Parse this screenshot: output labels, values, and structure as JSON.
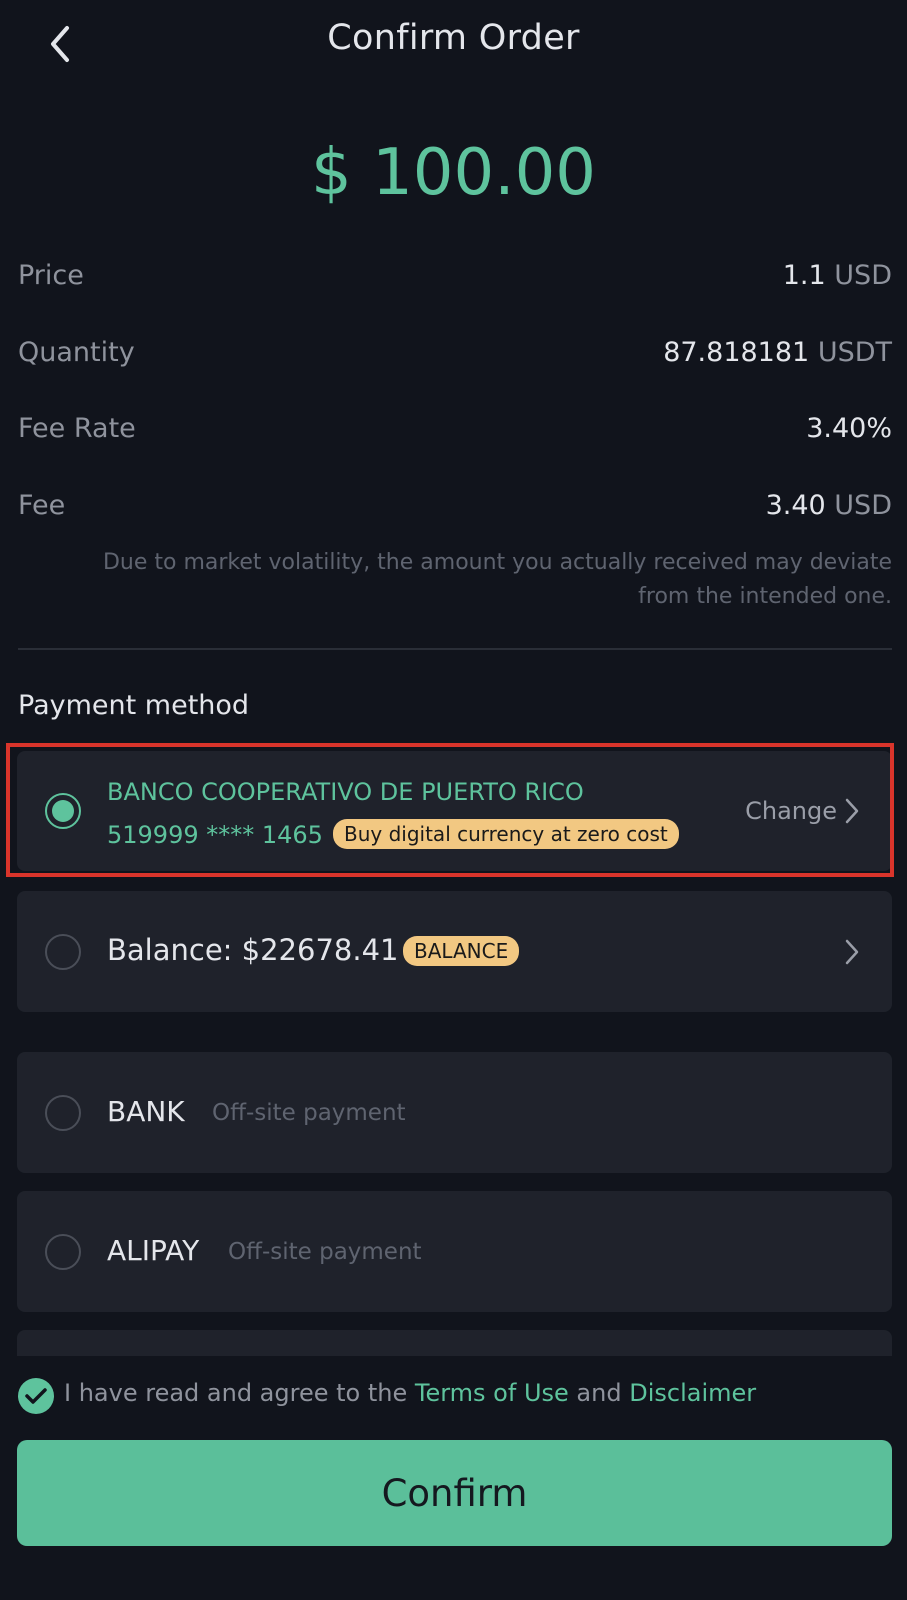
{
  "header": {
    "title": "Confirm Order",
    "back_icon": "chevron-left-icon"
  },
  "order": {
    "amount": "$ 100.00",
    "rows": [
      {
        "label": "Price",
        "value": "1.1",
        "unit": "USD"
      },
      {
        "label": "Quantity",
        "value": "87.818181",
        "unit": "USDT"
      },
      {
        "label": "Fee Rate",
        "value": "3.40%",
        "unit": ""
      },
      {
        "label": "Fee",
        "value": "3.40",
        "unit": "USD"
      }
    ],
    "note_line1": "Due to market volatility, the amount you actually received may deviate",
    "note_line2": "from the intended one."
  },
  "payment": {
    "title": "Payment method",
    "selected_card": {
      "bank_name": "BANCO COOPERATIVO DE PUERTO RICO",
      "card_number": "519999 **** 1465",
      "badge": "Buy digital currency at zero cost",
      "change_label": "Change"
    },
    "balance": {
      "label": "Balance: $22678.41",
      "badge": "BALANCE"
    },
    "methods": [
      {
        "name": "BANK",
        "sub": "Off-site payment"
      },
      {
        "name": "ALIPAY",
        "sub": "Off-site payment"
      }
    ]
  },
  "agreement": {
    "prefix": "I have read and agree to the",
    "terms": "Terms of Use",
    "and": "and",
    "disclaimer": "Disclaimer",
    "checked": true
  },
  "confirm_label": "Confirm",
  "colors": {
    "background": "#11141c",
    "accent": "#5ec39d",
    "card": "#1f222b",
    "badge": "#f2c882",
    "highlight": "#d9342b"
  }
}
